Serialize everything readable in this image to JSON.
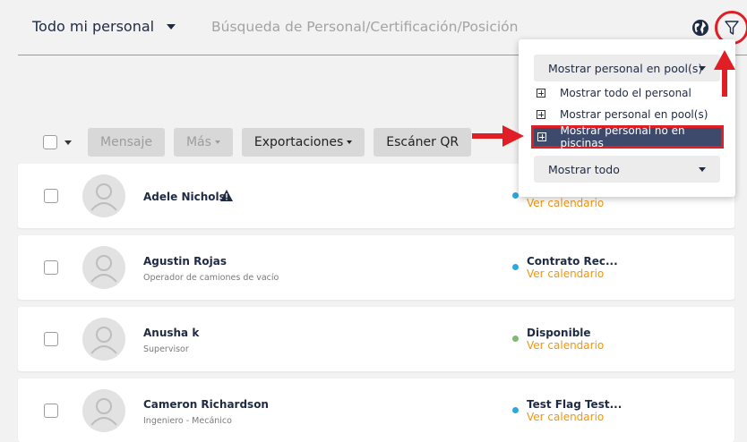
{
  "header": {
    "view_label": "Todo mi personal",
    "search_placeholder": "Búsqueda de Personal/Certificación/Posición"
  },
  "toolbar": {
    "mensaje": "Mensaje",
    "mas": "Más",
    "exportaciones": "Exportaciones",
    "escaner": "Escáner QR"
  },
  "rows": [
    {
      "name": "Adele Nichols",
      "role": "",
      "status": "",
      "status_color": "#29a9e0",
      "calendar": "Ver calendario"
    },
    {
      "name": "Agustin Rojas",
      "role": "Operador de camiones de vacío",
      "status": "Contrato Rec...",
      "status_color": "#29a9e0",
      "calendar": "Ver calendario"
    },
    {
      "name": "Anusha k",
      "role": "Supervisor",
      "status": "Disponible",
      "status_color": "#7dbb6e",
      "calendar": "Ver calendario"
    },
    {
      "name": "Cameron Richardson",
      "role": "Ingeniero - Mecánico",
      "status": "Test Flag Test...",
      "status_color": "#29a9e0",
      "calendar": "Ver calendario"
    }
  ],
  "filter_menu": {
    "pool_select": "Mostrar personal en pool(s)",
    "options": [
      "Mostrar todo el personal",
      "Mostrar personal en pool(s)",
      "Mostrar personal no en piscinas"
    ],
    "show_select": "Mostrar todo"
  },
  "colors": {
    "accent_red": "#e01e25",
    "link_orange": "#f0950c",
    "highlight_navy": "#3e4a6b"
  }
}
